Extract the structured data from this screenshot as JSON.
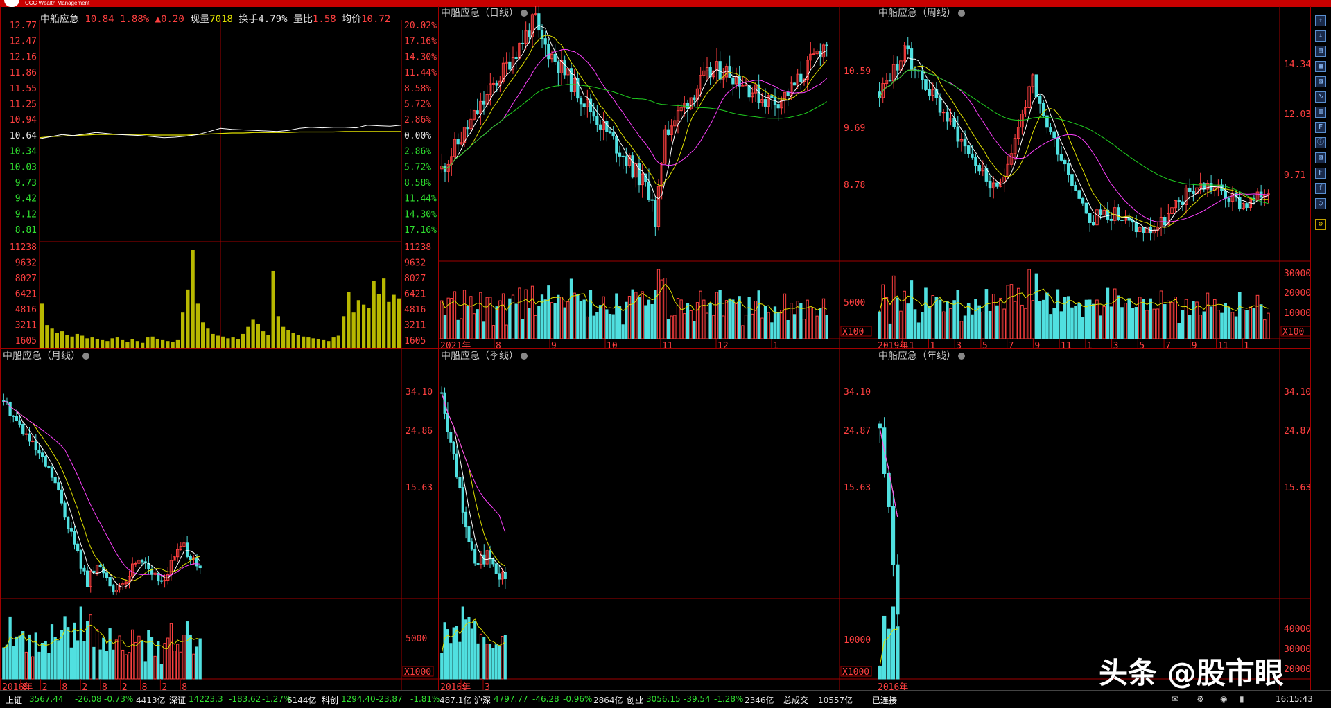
{
  "titlebar": {
    "text": "CCC Wealth Management"
  },
  "stock": {
    "name": "中船应急"
  },
  "quote": {
    "price": "10.84",
    "pct": "1.88%",
    "arrow": "▲",
    "change": "0.20",
    "volume_label": "现量",
    "volume": "7018",
    "turnover_label": "换手",
    "turnover": "4.79%",
    "ratio_label": "量比",
    "ratio": "1.58",
    "avg_label": "均价",
    "avg": "10.72"
  },
  "intraday": {
    "price_ticks": [
      "12.77",
      "12.47",
      "12.16",
      "11.86",
      "11.55",
      "11.25",
      "10.94",
      "10.64",
      "10.34",
      "10.03",
      "9.73",
      "9.42",
      "9.12",
      "8.81"
    ],
    "pct_ticks": [
      "20.02%",
      "17.16%",
      "14.30%",
      "11.44%",
      "8.58%",
      "5.72%",
      "2.86%",
      "0.00%",
      "2.86%",
      "5.72%",
      "8.58%",
      "11.44%",
      "14.30%",
      "17.16%"
    ],
    "vol_ticks": [
      "11238",
      "9632",
      "8027",
      "6421",
      "4816",
      "3211",
      "1605"
    ],
    "price_series": [
      10.58,
      10.62,
      10.66,
      10.64,
      10.67,
      10.7,
      10.68,
      10.66,
      10.65,
      10.64,
      10.62,
      10.6,
      10.61,
      10.63,
      10.66,
      10.72,
      10.78,
      10.76,
      10.75,
      10.74,
      10.73,
      10.72,
      10.74,
      10.78,
      10.8,
      10.79,
      10.8,
      10.8,
      10.79,
      10.84,
      10.83,
      10.82,
      10.84
    ],
    "avg_series": [
      10.6,
      10.62,
      10.63,
      10.64,
      10.65,
      10.66,
      10.66,
      10.66,
      10.66,
      10.66,
      10.65,
      10.65,
      10.65,
      10.65,
      10.66,
      10.67,
      10.68,
      10.69,
      10.69,
      10.7,
      10.7,
      10.7,
      10.7,
      10.71,
      10.71,
      10.71,
      10.71,
      10.72,
      10.72,
      10.72,
      10.72,
      10.72,
      10.72
    ],
    "volume_series": [
      5200,
      2800,
      2400,
      1900,
      2100,
      1700,
      1500,
      1800,
      1600,
      1300,
      1400,
      1200,
      1100,
      1000,
      1300,
      1400,
      1100,
      900,
      1200,
      1000,
      800,
      1400,
      1500,
      1200,
      1100,
      1000,
      900,
      1100,
      4200,
      6800,
      11238,
      5200,
      3100,
      2400,
      1800,
      1600,
      1500,
      1300,
      1400,
      1200,
      1800,
      2600,
      3400,
      2900,
      2100,
      1700,
      8900,
      3800,
      2600,
      2200,
      1900,
      1700,
      1500,
      1400,
      1300,
      1200,
      1100,
      1000,
      1400,
      1600,
      3800,
      6500,
      4200,
      5600,
      5100,
      4700,
      7800,
      6300,
      8027,
      5400,
      6200,
      5800
    ]
  },
  "panels": {
    "daily": {
      "title": "中船应急（日线）",
      "price_ticks": [
        "10.59",
        "9.69",
        "8.78"
      ],
      "vol_tick": "5000",
      "unit": "X100",
      "x_labels": [
        "2021年",
        "8",
        "9",
        "10",
        "11",
        "12",
        "1"
      ]
    },
    "weekly": {
      "title": "中船应急（周线）",
      "price_ticks": [
        "14.34",
        "12.03",
        "9.71"
      ],
      "vol_ticks": [
        "30000",
        "20000",
        "10000"
      ],
      "unit": "X100",
      "x_labels": [
        "2019年",
        "11",
        "1",
        "3",
        "5",
        "7",
        "9",
        "11",
        "1",
        "3",
        "5",
        "7",
        "9",
        "11",
        "1"
      ]
    },
    "monthly": {
      "title": "中船应急（月线）",
      "price_ticks": [
        "34.10",
        "24.86",
        "15.63"
      ],
      "vol_tick": "5000",
      "unit": "X1000",
      "x_labels": [
        "2016年",
        "8",
        "2",
        "8",
        "2",
        "8",
        "2",
        "8",
        "2",
        "8"
      ]
    },
    "quarterly": {
      "title": "中船应急（季线）",
      "price_ticks": [
        "34.10",
        "24.87",
        "15.63"
      ],
      "vol_tick": "10000",
      "unit": "X1000",
      "x_labels": [
        "2016年",
        "9",
        "3"
      ]
    },
    "yearly": {
      "title": "中船应急（年线）",
      "price_ticks": [
        "34.10",
        "24.87",
        "15.63"
      ],
      "vol_ticks": [
        "40000",
        "30000",
        "20000"
      ],
      "x_labels": [
        "2016年"
      ]
    }
  },
  "status": {
    "sh_label": "上证",
    "sh_val": "3567.44",
    "sh_chg": "-26.08",
    "sh_pct": "-0.73%",
    "sh_amt": "4413亿",
    "sz_label": "深证",
    "sz_val": "14223.3",
    "sz_chg": "-183.62",
    "sz_pct": "-1.27%",
    "sz_amt": "6144亿",
    "kc_label": "科创",
    "kc_val": "1294.40",
    "kc_chg": "-23.87",
    "kc_pct": "-1.81%",
    "kc_amt": "487.1亿",
    "hs_label": "沪深",
    "hs_val": "4797.77",
    "hs_chg": "-46.28",
    "hs_pct": "-0.96%",
    "hs_amt": "2864亿",
    "cy_label": "创业",
    "cy_val": "3056.15",
    "cy_chg": "-39.54",
    "cy_pct": "-1.28%",
    "cy_amt": "2346亿",
    "total_label": "总成交",
    "total_val": "10557亿",
    "conn": "已连接",
    "time": "16:15:43"
  },
  "watermark": "头条 @股市眼",
  "sidebar_icons": [
    "arrow-up-icon",
    "arrow-down-icon",
    "kline-icon",
    "grid-icon",
    "line-icon",
    "bar-icon",
    "list-icon",
    "fin-icon",
    "info-icon",
    "doc-icon",
    "f10-icon",
    "fx-icon",
    "circle-icon",
    "gear-icon"
  ],
  "colors": {
    "up": "#ff4040",
    "down": "#50e0e0",
    "ma5": "#ffffff",
    "ma10": "#e0e000",
    "ma20": "#ff40ff",
    "ma60": "#20d020",
    "grid": "#a00000"
  }
}
